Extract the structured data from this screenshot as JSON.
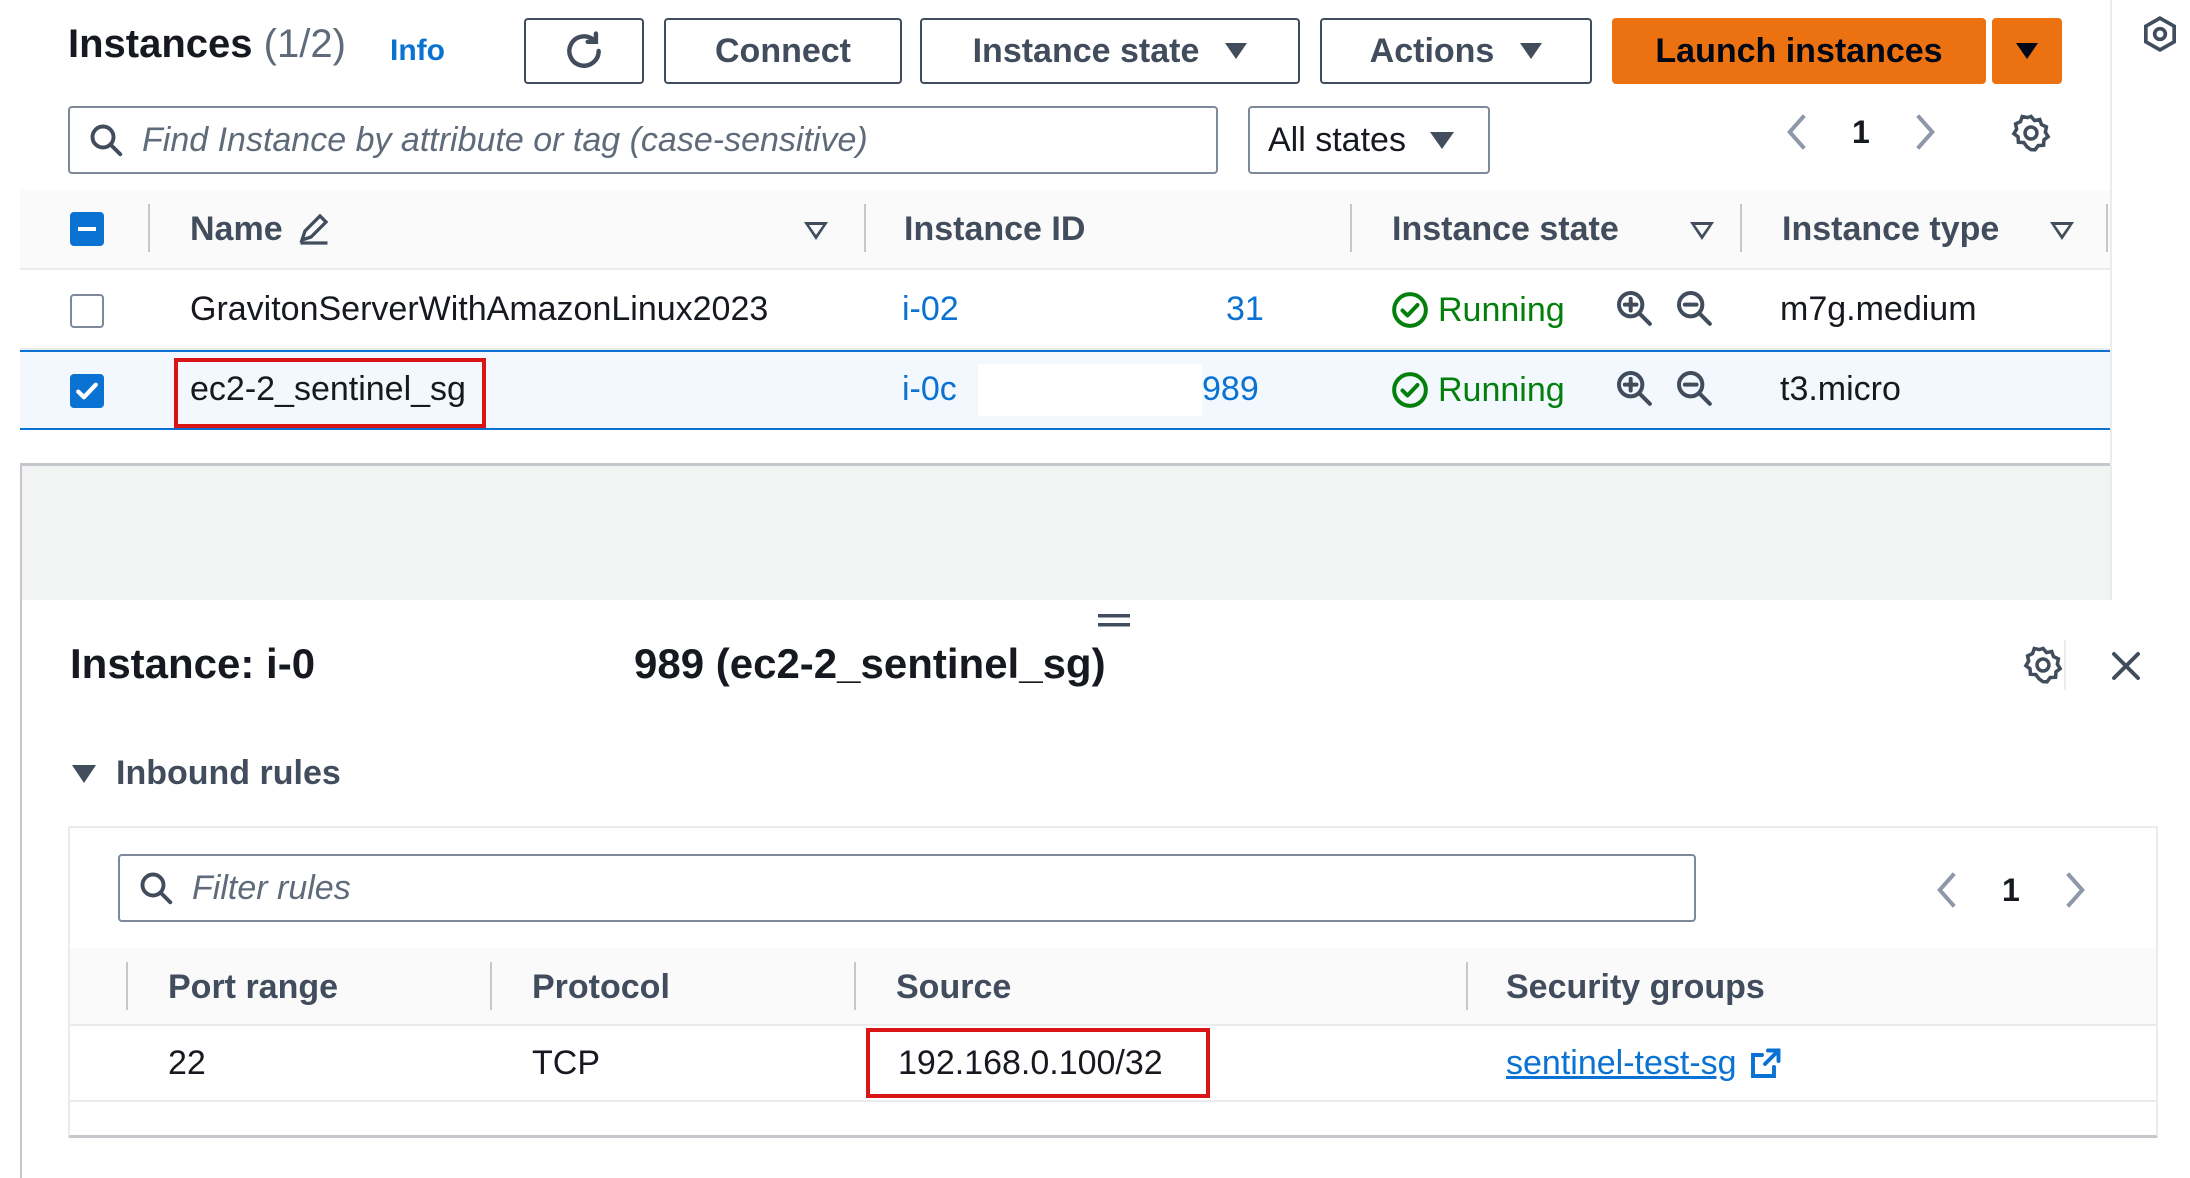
{
  "header": {
    "title": "Instances",
    "count": "(1/2)",
    "info_label": "Info"
  },
  "toolbar": {
    "connect_label": "Connect",
    "instance_state_label": "Instance state",
    "actions_label": "Actions",
    "launch_label": "Launch instances"
  },
  "search": {
    "placeholder": "Find Instance by attribute or tag (case-sensitive)"
  },
  "filter": {
    "selected": "All states"
  },
  "pagination": {
    "page": "1"
  },
  "table": {
    "columns": [
      "Name",
      "Instance ID",
      "Instance state",
      "Instance type"
    ],
    "rows": [
      {
        "name": "GravitonServerWithAmazonLinux2023",
        "id_prefix": "i-02",
        "id_suffix": "31",
        "state": "Running",
        "type": "m7g.medium",
        "selected": false
      },
      {
        "name": "ec2-2_sentinel_sg",
        "id_prefix": "i-0c",
        "id_suffix": "989",
        "state": "Running",
        "type": "t3.micro",
        "selected": true
      }
    ]
  },
  "detail": {
    "title_prefix": "Instance: i-0",
    "title_suffix": "989 (ec2-2_sentinel_sg)",
    "section": "Inbound rules",
    "filter_placeholder": "Filter rules",
    "page": "1",
    "columns": [
      "Port range",
      "Protocol",
      "Source",
      "Security groups"
    ],
    "rows": [
      {
        "port_range": "22",
        "protocol": "TCP",
        "source": "192.168.0.100/32",
        "security_group": "sentinel-test-sg"
      }
    ]
  },
  "colors": {
    "primary": "#ec7211",
    "link": "#0972d3",
    "success": "#037f0c",
    "highlight": "#d91515"
  },
  "icons": [
    "refresh-icon",
    "search-icon",
    "pencil-icon",
    "settings-icon",
    "close-icon",
    "zoom-in-icon",
    "zoom-out-icon",
    "status-success-icon",
    "external-link-icon",
    "panel-icon",
    "drag-handle-icon"
  ]
}
